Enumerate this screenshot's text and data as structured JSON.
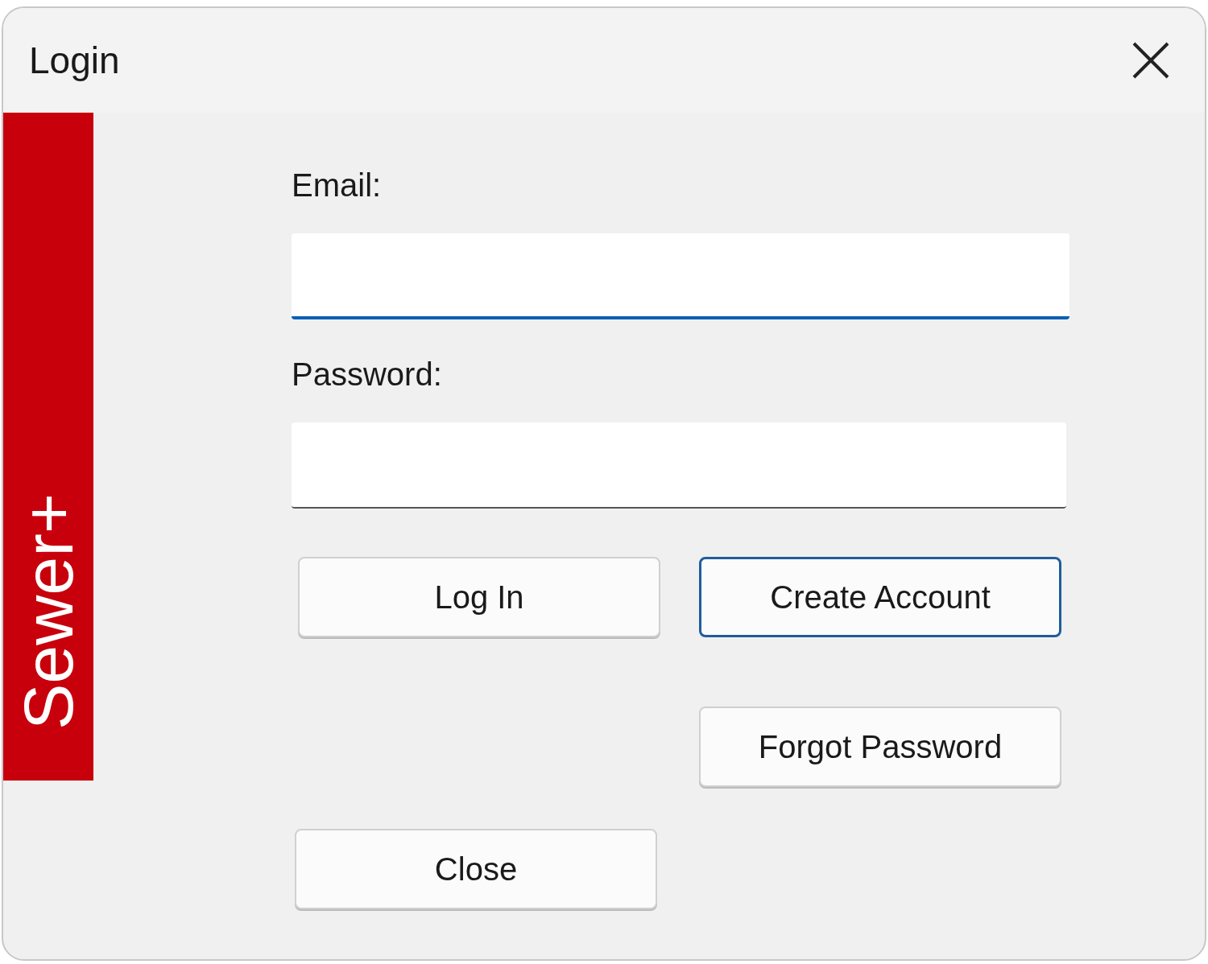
{
  "window": {
    "title": "Login"
  },
  "brand": {
    "text": "Sewer+"
  },
  "fields": [
    {
      "label": "Email:",
      "focused": true
    },
    {
      "label": "Password:",
      "focused": false
    }
  ],
  "buttons": [
    {
      "label": "Log In",
      "default": false
    },
    {
      "label": "Create Account",
      "default": true
    },
    {
      "label": "Forgot Password",
      "default": false
    },
    {
      "label": "Close",
      "default": false
    }
  ]
}
